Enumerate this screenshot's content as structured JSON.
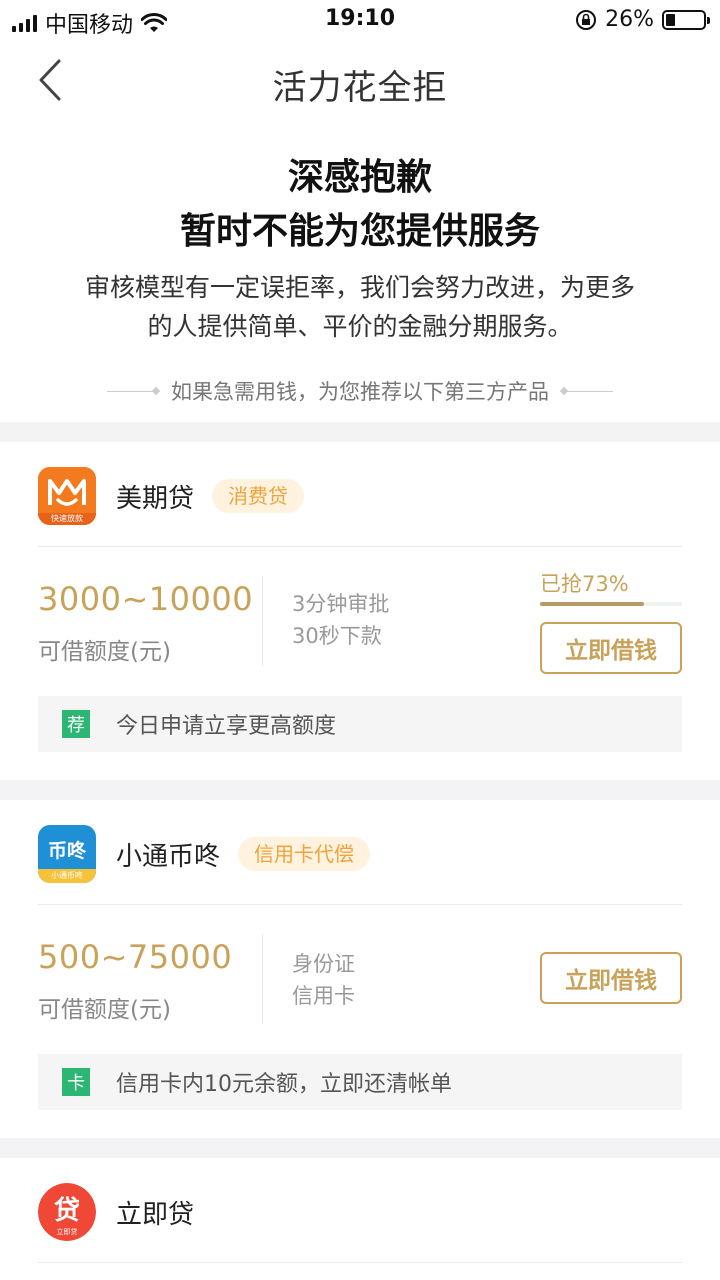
{
  "status_bar": {
    "carrier": "中国移动",
    "time": "19:10",
    "battery": "26%"
  },
  "nav": {
    "title": "活力花全拒"
  },
  "notice": {
    "line1": "深感抱歉",
    "line2": "暂时不能为您提供服务",
    "description": "审核模型有一定误拒率，我们会努力改进，为更多的人提供简单、平价的金融分期服务。",
    "recommend": "如果急需用钱，为您推荐以下第三方产品"
  },
  "products": [
    {
      "name": "美期贷",
      "logo_caption": "快速放款",
      "tag": "消费贷",
      "amount": "3000~10000",
      "amount_label": "可借额度(元)",
      "features": [
        "3分钟审批",
        "30秒下款"
      ],
      "grabbed_text": "已抢73%",
      "grabbed_fraction": 0.73,
      "cta": "立即借钱",
      "promo_badge": "荐",
      "promo_text": "今日申请立享更高额度"
    },
    {
      "name": "小通币咚",
      "logo_text": "币咚",
      "logo_caption": "小通币咚",
      "tag": "信用卡代偿",
      "amount": "500~75000",
      "amount_label": "可借额度(元)",
      "features": [
        "身份证",
        "信用卡"
      ],
      "cta": "立即借钱",
      "promo_badge": "卡",
      "promo_text": "信用卡内10元余额，立即还清帐单"
    },
    {
      "name": "立即贷",
      "logo_text": "贷",
      "logo_caption": "立即贷"
    }
  ],
  "colors": {
    "accent_gold": "#c9a25a",
    "tag_orange": "#f0a33c",
    "promo_green": "#2bb673",
    "logo_orange": "#f47a20",
    "logo_blue": "#1f8fd6",
    "logo_red": "#ef4836"
  }
}
